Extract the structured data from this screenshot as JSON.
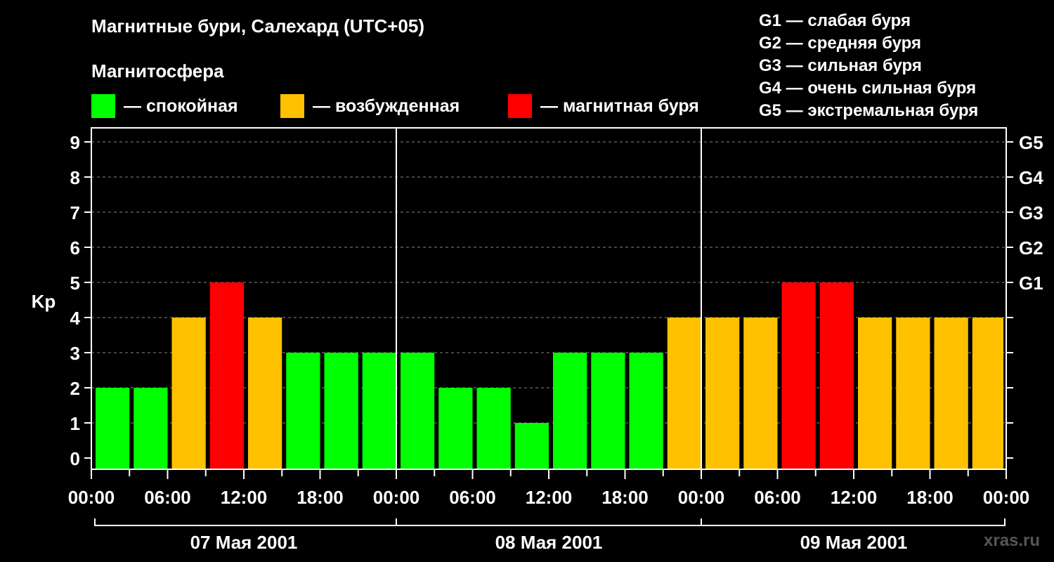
{
  "header": {
    "title": "Магнитные бури, Салехард (UTC+05)",
    "subtitle": "Магнитосфера"
  },
  "legend": [
    {
      "label": "— спокойная",
      "color": "#00ff00"
    },
    {
      "label": "— возбужденная",
      "color": "#ffc000"
    },
    {
      "label": "— магнитная буря",
      "color": "#ff0000"
    }
  ],
  "g_legend": [
    "G1 — слабая буря",
    "G2 — средняя буря",
    "G3 — сильная буря",
    "G4 — очень сильная буря",
    "G5 — экстремальная буря"
  ],
  "watermark": "xras.ru",
  "chart_data": {
    "type": "bar",
    "ylabel": "Kp",
    "ylim": [
      0,
      9
    ],
    "y_ticks": [
      0,
      1,
      2,
      3,
      4,
      5,
      6,
      7,
      8,
      9
    ],
    "right_axis_labels": [
      {
        "value": 5,
        "label": "G1"
      },
      {
        "value": 6,
        "label": "G2"
      },
      {
        "value": 7,
        "label": "G3"
      },
      {
        "value": 8,
        "label": "G4"
      },
      {
        "value": 9,
        "label": "G5"
      }
    ],
    "x_tick_labels": [
      "00:00",
      "06:00",
      "12:00",
      "18:00",
      "00:00",
      "06:00",
      "12:00",
      "18:00",
      "00:00",
      "06:00",
      "12:00",
      "18:00",
      "00:00"
    ],
    "days": [
      "07 Мая 2001",
      "08 Мая 2001",
      "09 Мая 2001"
    ],
    "grid": "dashed horizontal",
    "colors": {
      "quiet": "#00ff00",
      "active": "#ffc000",
      "storm": "#ff0000"
    },
    "categories": [
      "07 00:00",
      "07 03:00",
      "07 06:00",
      "07 09:00",
      "07 12:00",
      "07 15:00",
      "07 18:00",
      "07 21:00",
      "08 00:00",
      "08 03:00",
      "08 06:00",
      "08 09:00",
      "08 12:00",
      "08 15:00",
      "08 18:00",
      "08 21:00",
      "09 00:00",
      "09 03:00",
      "09 06:00",
      "09 09:00",
      "09 12:00",
      "09 15:00",
      "09 18:00",
      "09 21:00"
    ],
    "values": [
      2,
      2,
      4,
      5,
      4,
      3,
      3,
      3,
      3,
      2,
      2,
      1,
      3,
      3,
      3,
      4,
      4,
      4,
      5,
      5,
      4,
      4,
      4,
      4
    ]
  }
}
